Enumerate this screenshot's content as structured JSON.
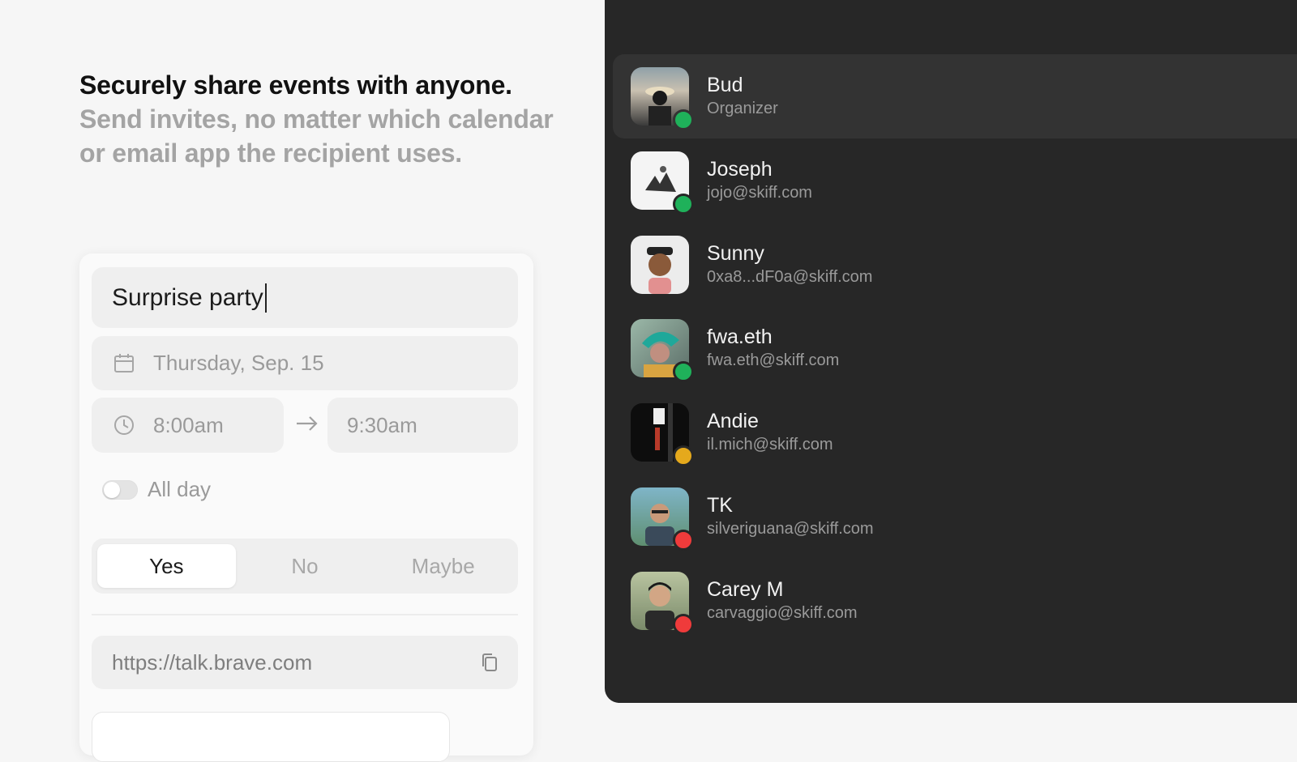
{
  "hero": {
    "headline": "Securely share events with anyone.",
    "subhead": "Send invites, no matter which calendar or email app the recipient uses."
  },
  "event_form": {
    "title_value": "Surprise party",
    "date": "Thursday, Sep. 15",
    "start_time": "8:00am",
    "end_time": "9:30am",
    "all_day_label": "All day",
    "all_day_enabled": false,
    "rsvp_options": [
      "Yes",
      "No",
      "Maybe"
    ],
    "rsvp_selected": "Yes",
    "meeting_url": "https://talk.brave.com",
    "icons": {
      "date": "calendar-icon",
      "time": "clock-icon",
      "arrow": "arrow-right-icon",
      "copy": "copy-icon"
    }
  },
  "attendees": [
    {
      "name": "Bud",
      "detail": "Organizer",
      "status": "green",
      "status_color": "#1fb15a"
    },
    {
      "name": "Joseph",
      "detail": "jojo@skiff.com",
      "status": "green",
      "status_color": "#1fb15a"
    },
    {
      "name": "Sunny",
      "detail": "0xa8...dF0a@skiff.com",
      "status": "none",
      "status_color": ""
    },
    {
      "name": "fwa.eth",
      "detail": "fwa.eth@skiff.com",
      "status": "green",
      "status_color": "#1fb15a"
    },
    {
      "name": "Andie",
      "detail": "il.mich@skiff.com",
      "status": "yellow",
      "status_color": "#e5a91c"
    },
    {
      "name": "TK",
      "detail": "silveriguana@skiff.com",
      "status": "red",
      "status_color": "#ef3b3b"
    },
    {
      "name": "Carey M",
      "detail": "carvaggio@skiff.com",
      "status": "red",
      "status_color": "#ef3b3b"
    }
  ],
  "colors": {
    "page_bg": "#f6f6f6",
    "panel_bg": "#272727",
    "highlight_row": "#333333"
  }
}
